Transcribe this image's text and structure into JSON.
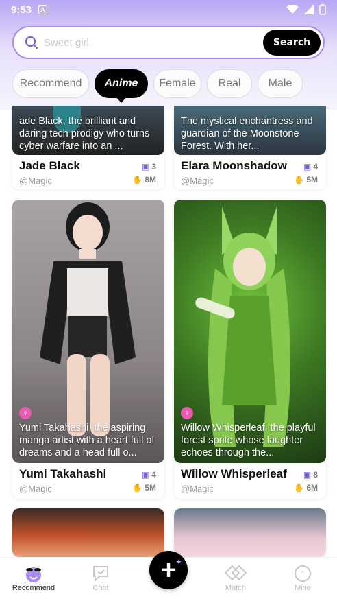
{
  "status": {
    "time": "9:53",
    "notif": "A"
  },
  "search": {
    "placeholder": "Sweet girl",
    "button": "Search"
  },
  "tabs": [
    "Recommend",
    "Anime",
    "Female",
    "Real",
    "Male"
  ],
  "active_tab": "Anime",
  "cards": [
    {
      "name": "Jade Black",
      "handle": "@Magic",
      "description": "ade Black, the brilliant and daring tech prodigy who turns cyber warfare into an ...",
      "images": "3",
      "likes": "8M"
    },
    {
      "name": "Elara Moonshadow",
      "handle": "@Magic",
      "description": "The mystical enchantress and guardian of the Moonstone Forest. With her...",
      "images": "4",
      "likes": "5M"
    },
    {
      "name": "Yumi Takahashi",
      "handle": "@Magic",
      "description": "Yumi Takahashi, the aspiring manga artist with a heart full of dreams and a head full o...",
      "images": "4",
      "likes": "5M"
    },
    {
      "name": "Willow Whisperleaf",
      "handle": "@Magic",
      "description": " Willow Whisperleaf, the playful forest sprite whose laughter echoes through the...",
      "images": "8",
      "likes": "6M"
    }
  ],
  "nav": {
    "recommend": "Recommend",
    "chat": "Chat",
    "match": "Match",
    "mine": "Mine"
  },
  "colors": {
    "accent": "#a98af0",
    "header_gradient_top": "#b9a6f4",
    "gender_badge": "#e95bb0"
  }
}
